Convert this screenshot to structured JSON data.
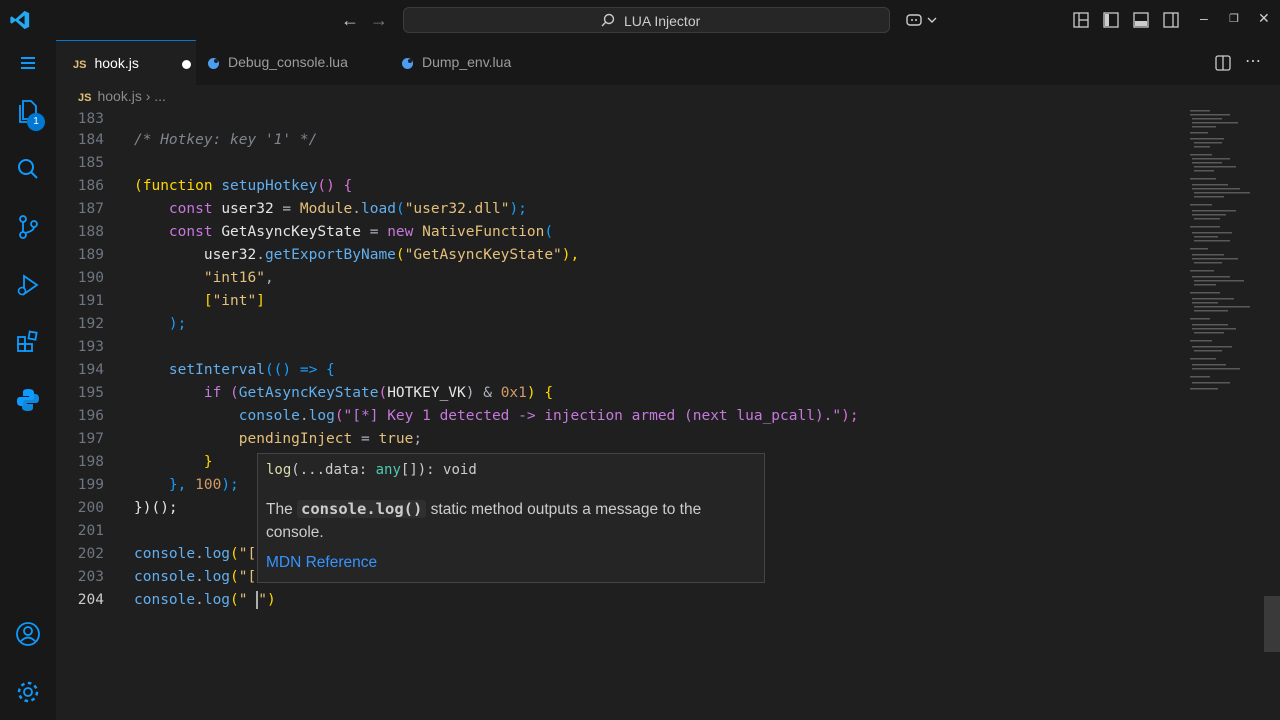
{
  "titlebar": {
    "search_label": "LUA Injector",
    "back_icon": "arrow-left-icon",
    "forward_icon": "arrow-right-icon"
  },
  "tabs": [
    {
      "label": "hook.js",
      "icon": "JS",
      "active": true,
      "modified": true
    },
    {
      "label": "Debug_console.lua",
      "active": false
    },
    {
      "label": "Dump_env.lua",
      "active": false
    }
  ],
  "breadcrumb": {
    "file": "hook.js",
    "icon": "JS",
    "more": "..."
  },
  "activity_badge": "1",
  "lines": [
    {
      "n": "183"
    },
    {
      "n": "184"
    },
    {
      "n": "185"
    },
    {
      "n": "186"
    },
    {
      "n": "187"
    },
    {
      "n": "188"
    },
    {
      "n": "189"
    },
    {
      "n": "190"
    },
    {
      "n": "191"
    },
    {
      "n": "192"
    },
    {
      "n": "193"
    },
    {
      "n": "194"
    },
    {
      "n": "195"
    },
    {
      "n": "196"
    },
    {
      "n": "197"
    },
    {
      "n": "198"
    },
    {
      "n": "199"
    },
    {
      "n": "200"
    },
    {
      "n": "201"
    },
    {
      "n": "202"
    },
    {
      "n": "203"
    },
    {
      "n": "204"
    }
  ],
  "code": {
    "l184": "/* Hotkey: key '1' */",
    "l186_a": "(function ",
    "l186_b": "setupHotkey",
    "l186_c": "() {",
    "l187_a": "    const ",
    "l187_b": "user32",
    "l187_c": " = ",
    "l187_d": "Module",
    "l187_e": ".",
    "l187_f": "load",
    "l187_g": "(",
    "l187_h": "\"user32.dll\"",
    "l187_i": ");",
    "l188_a": "    const ",
    "l188_b": "GetAsyncKeyState",
    "l188_c": " = ",
    "l188_d": "new ",
    "l188_e": "NativeFunction",
    "l188_f": "(",
    "l189_a": "        user32",
    "l189_b": ".",
    "l189_c": "getExportByName",
    "l189_d": "(",
    "l189_e": "\"GetAsyncKeyState\"",
    "l189_f": "),",
    "l190_a": "        ",
    "l190_b": "\"int16\"",
    "l190_c": ",",
    "l191_a": "        [",
    "l191_b": "\"int\"",
    "l191_c": "]",
    "l192": "    );",
    "l194_a": "    ",
    "l194_b": "setInterval",
    "l194_c": "(() => {",
    "l195_a": "        if (",
    "l195_b": "GetAsyncKeyState",
    "l195_c": "(",
    "l195_d": "HOTKEY_VK",
    "l195_e": ") & ",
    "l195_f": "0x1",
    "l195_g": ") {",
    "l196_a": "            console",
    "l196_b": ".",
    "l196_c": "log",
    "l196_d": "(",
    "l196_e": "\"[*] Key 1 detected -> injection armed (next lua_pcall).\"",
    "l196_f": ");",
    "l197_a": "            pendingInject",
    "l197_b": " = ",
    "l197_c": "true",
    "l197_d": ";",
    "l198": "        }",
    "l199_a": "    }, ",
    "l199_b": "100",
    "l199_c": ");",
    "l200": "})();",
    "l202_a": "console",
    "l202_b": ".",
    "l202_c": "log",
    "l202_d": "(",
    "l202_e": "\"[",
    "l203_a": "console",
    "l203_b": ".",
    "l203_c": "log",
    "l203_d": "(",
    "l203_e": "\"[",
    "l204_a": "console",
    "l204_b": ".",
    "l204_c": "log",
    "l204_d": "(",
    "l204_e": "\" ",
    "l204_f": "\"",
    "l204_g": ")"
  },
  "hover": {
    "signature": "log(...data: any[]): void",
    "sig_name": "log",
    "sig_params": "(...data: ",
    "sig_type": "any",
    "sig_rest": "[]): void",
    "desc_1": "The ",
    "desc_code": "console.log()",
    "desc_2": " static method outputs a message to the console.",
    "reference": "MDN Reference"
  },
  "colors": {
    "accent": "#0078d4",
    "background": "#1f1f1f"
  }
}
